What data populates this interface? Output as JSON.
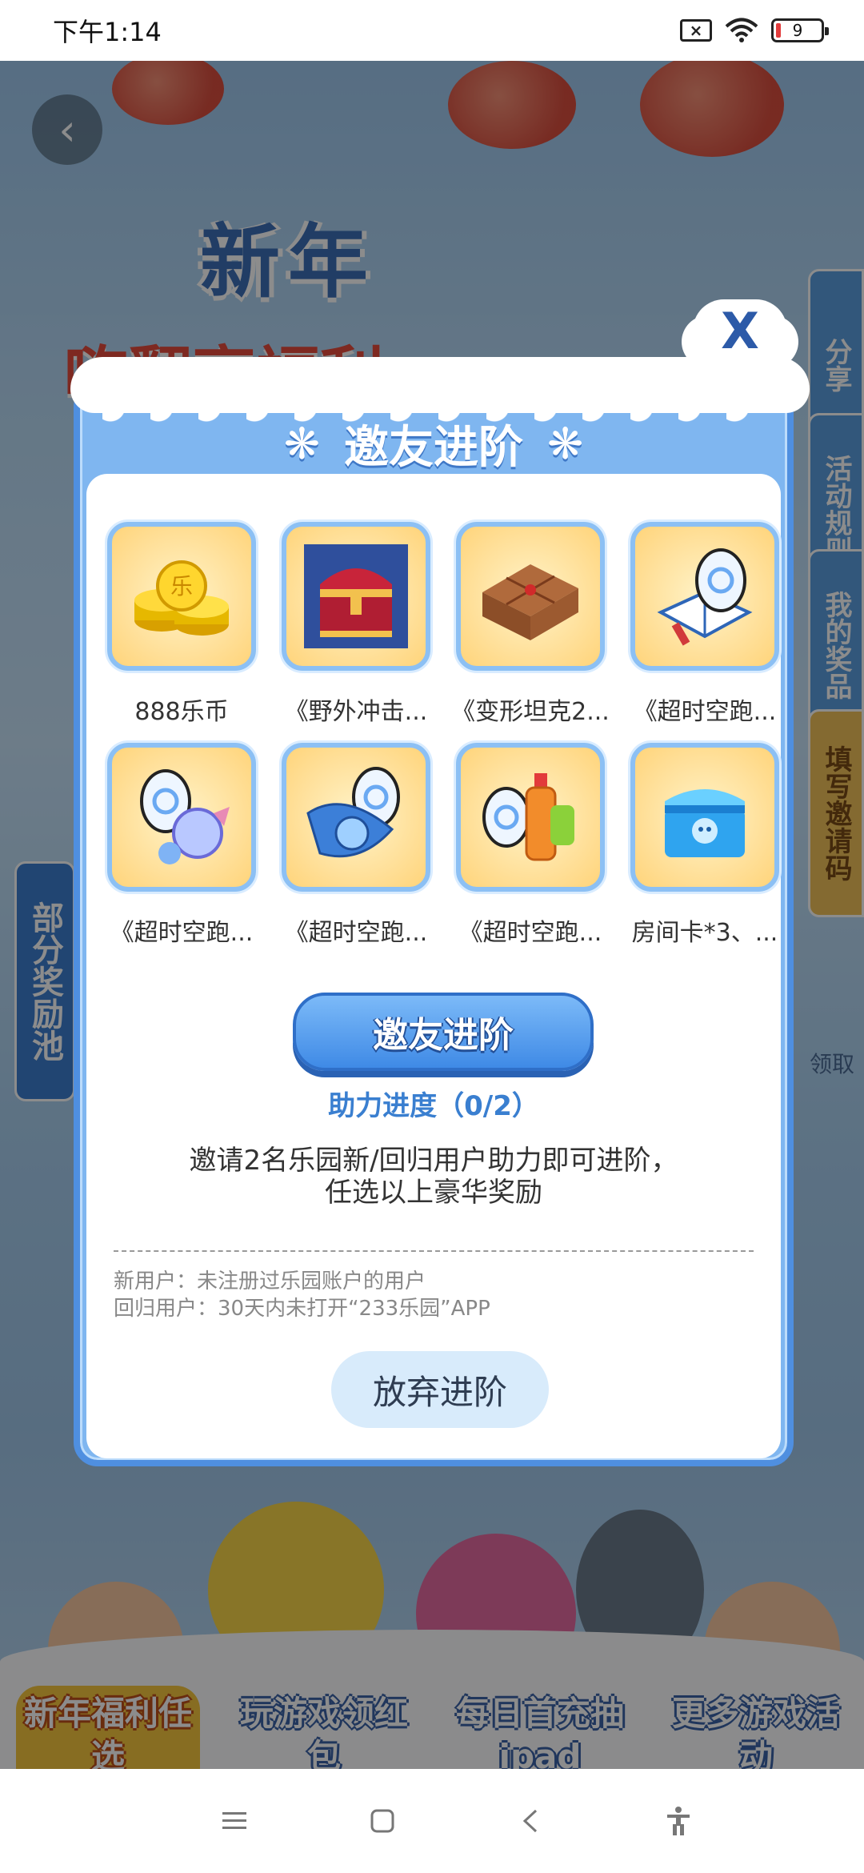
{
  "status": {
    "time": "下午1:14",
    "battery": "9"
  },
  "background": {
    "banner_line1": "新年",
    "banner_line2": "嗨翻享福利",
    "side_tabs": [
      "分享",
      "活动规则",
      "我的奖品",
      "填写邀请码"
    ],
    "left_pool": "部分奖励池",
    "right_claim": "领取",
    "bottom_nav": [
      "新年福利任选",
      "玩游戏领红包",
      "每日首充抽ipad",
      "更多游戏活动"
    ]
  },
  "modal": {
    "title": "邀友进阶",
    "close_label": "X",
    "rewards": [
      {
        "label": "888乐币",
        "icon": "coins-icon"
      },
      {
        "label": "《野外冲击...",
        "icon": "treasure-chest-icon"
      },
      {
        "label": "《变形坦克2...",
        "icon": "gift-box-icon"
      },
      {
        "label": "《超时空跑...",
        "icon": "egg-book-icon"
      },
      {
        "label": "《超时空跑...",
        "icon": "egg-potion-icon"
      },
      {
        "label": "《超时空跑...",
        "icon": "egg-orb-icon"
      },
      {
        "label": "《超时空跑...",
        "icon": "egg-bottle-icon"
      },
      {
        "label": "房间卡*3、...",
        "icon": "blue-box-icon"
      }
    ],
    "primary_button": "邀友进阶",
    "progress": "助力进度（0/2）",
    "desc_line1": "邀请2名乐园新/回归用户助力即可进阶，",
    "desc_line2": "任选以上豪华奖励",
    "note_line1": "新用户：未注册过乐园账户的用户",
    "note_line2": "回归用户：30天内未打开“233乐园”APP",
    "secondary_button": "放弃进阶"
  },
  "colors": {
    "accent": "#4f8fe0",
    "modal_bg": "#7fb6f0",
    "progress": "#3a7fd0"
  }
}
